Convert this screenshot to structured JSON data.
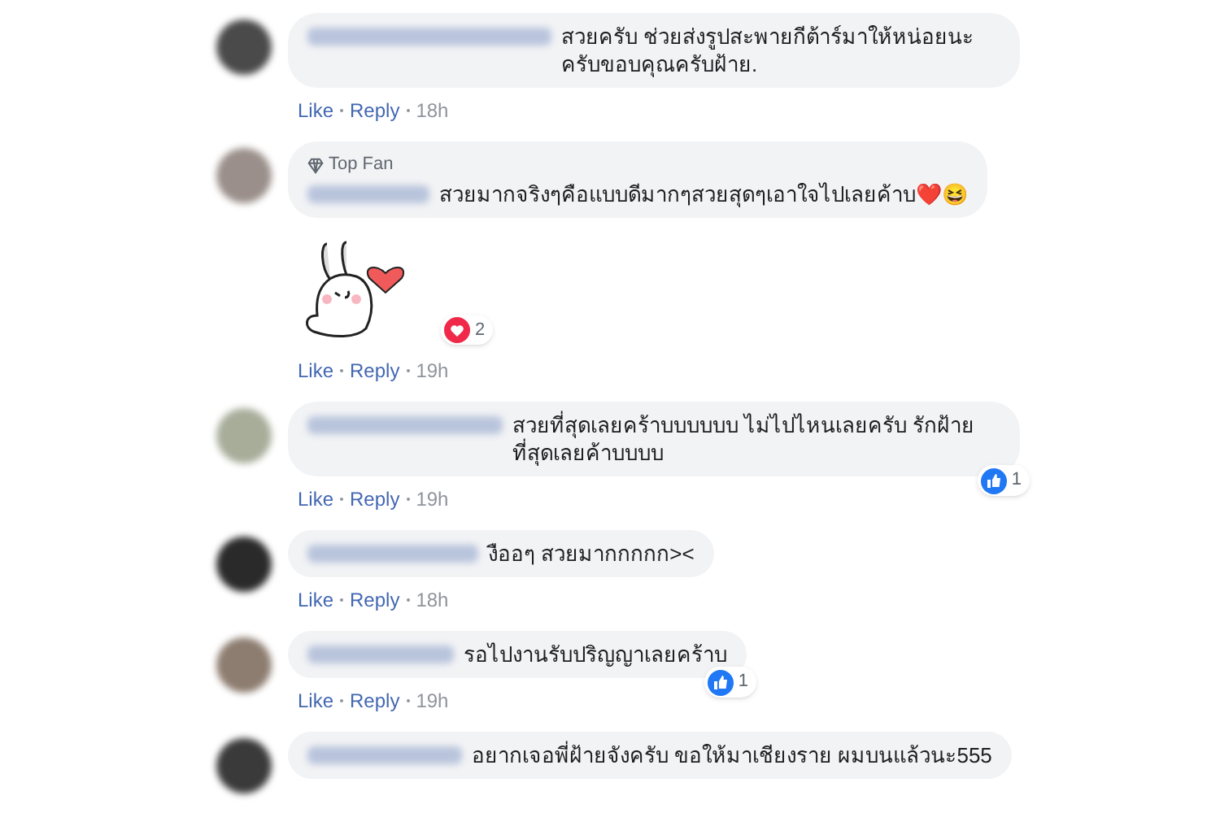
{
  "comments": [
    {
      "text": "สวยครับ ช่วยส่งรูปสะพายกีต้าร์มาให้หน่อยนะครับขอบคุณครับฝ้าย.",
      "actions": {
        "like": "Like",
        "reply": "Reply",
        "time": "18h"
      }
    },
    {
      "badge": "Top Fan",
      "text": "สวยมากจริงๆคือแบบดีมากๆสวยสุดๆเอาใจไปเลยค้าบ❤️😆",
      "sticker": true,
      "reaction": {
        "kind": "love",
        "count": "2"
      },
      "actions": {
        "like": "Like",
        "reply": "Reply",
        "time": "19h"
      }
    },
    {
      "text": "สวยที่สุดเลยคร้าบบบบบบ ไม่ไปไหนเลยครับ รักฝ้ายที่สุดเลยค้าบบบบ",
      "reaction": {
        "kind": "like",
        "count": "1"
      },
      "actions": {
        "like": "Like",
        "reply": "Reply",
        "time": "19h"
      }
    },
    {
      "text": "งืออๆ สวยมากกกกก><",
      "actions": {
        "like": "Like",
        "reply": "Reply",
        "time": "18h"
      }
    },
    {
      "text": "รอไปงานรับปริญญาเลยคร้าบ",
      "reaction": {
        "kind": "like",
        "count": "1"
      },
      "actions": {
        "like": "Like",
        "reply": "Reply",
        "time": "19h"
      }
    },
    {
      "text": "อยากเจอพี่ฝ้ายจังครับ ขอให้มาเชียงราย ผมบนแล้วนะ555"
    }
  ]
}
